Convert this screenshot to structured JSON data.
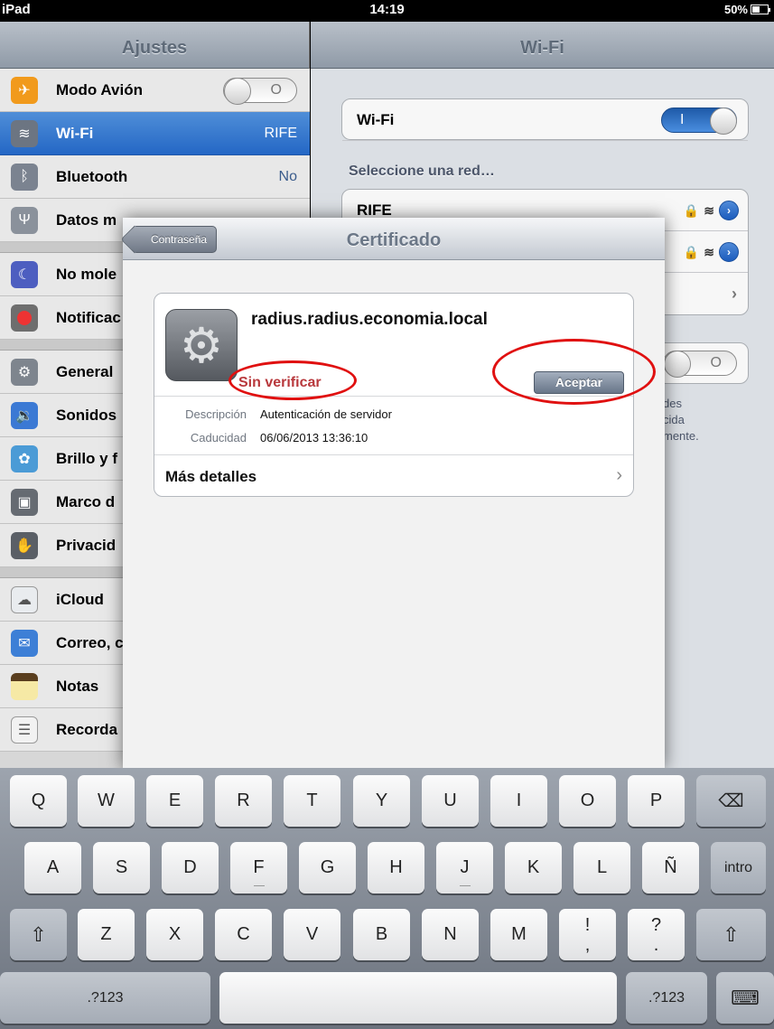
{
  "status": {
    "device": "iPad",
    "time": "14:19",
    "battery": "50%"
  },
  "master": {
    "title": "Ajustes",
    "rows": [
      {
        "label": "Modo Avión",
        "value": "O",
        "icon": "airplane-icon"
      },
      {
        "label": "Wi-Fi",
        "value": "RIFE",
        "icon": "wifi-icon"
      },
      {
        "label": "Bluetooth",
        "value": "No",
        "icon": "bluetooth-icon"
      },
      {
        "label": "Datos m",
        "value": "",
        "icon": "cellular-icon"
      },
      {
        "label": "No mole",
        "value": "",
        "icon": "moon-icon"
      },
      {
        "label": "Notificac",
        "value": "",
        "icon": "notifications-icon"
      },
      {
        "label": "General",
        "value": "",
        "icon": "gear-icon"
      },
      {
        "label": "Sonidos",
        "value": "",
        "icon": "speaker-icon"
      },
      {
        "label": "Brillo y f",
        "value": "",
        "icon": "flower-icon"
      },
      {
        "label": "Marco d",
        "value": "",
        "icon": "frame-icon"
      },
      {
        "label": "Privacid",
        "value": "",
        "icon": "hand-icon"
      },
      {
        "label": "iCloud",
        "value": "",
        "icon": "cloud-icon"
      },
      {
        "label": "Correo, c",
        "value": "",
        "icon": "mail-icon"
      },
      {
        "label": "Notas",
        "value": "",
        "icon": "notes-icon"
      },
      {
        "label": "Recorda",
        "value": "",
        "icon": "reminders-icon"
      }
    ]
  },
  "detail": {
    "title": "Wi-Fi",
    "wifi_label": "Wi-Fi",
    "wifi_switch": "I",
    "choose_network": "Seleccione una red…",
    "network": "RIFE",
    "switch2": "O",
    "footnote": [
      "des",
      "cida",
      "mente."
    ]
  },
  "sheet": {
    "back": "Contraseña",
    "title": "Certificado",
    "cert_name": "radius.radius.economia.local",
    "status": "Sin verificar",
    "accept": "Aceptar",
    "desc_key": "Descripción",
    "desc_val": "Autenticación de servidor",
    "exp_key": "Caducidad",
    "exp_val": "06/06/2013 13:36:10",
    "more": "Más detalles"
  },
  "keyboard": {
    "row1": [
      "Q",
      "W",
      "E",
      "R",
      "T",
      "Y",
      "U",
      "I",
      "O",
      "P"
    ],
    "row2": [
      "A",
      "S",
      "D",
      "F",
      "G",
      "H",
      "J",
      "K",
      "L",
      "Ñ"
    ],
    "row3": [
      "Z",
      "X",
      "C",
      "V",
      "B",
      "N",
      "M"
    ],
    "return": "intro",
    "numbers": ".?123",
    "punct1_top": "!",
    "punct1_bot": ",",
    "punct2_top": "?",
    "punct2_bot": ".",
    "backspace": "⌫",
    "shift": "⇧",
    "hide": "⌨"
  },
  "colors": {
    "accent": "#2467c5",
    "unverified": "#b8383c",
    "highlight_ring": "#e01010"
  }
}
